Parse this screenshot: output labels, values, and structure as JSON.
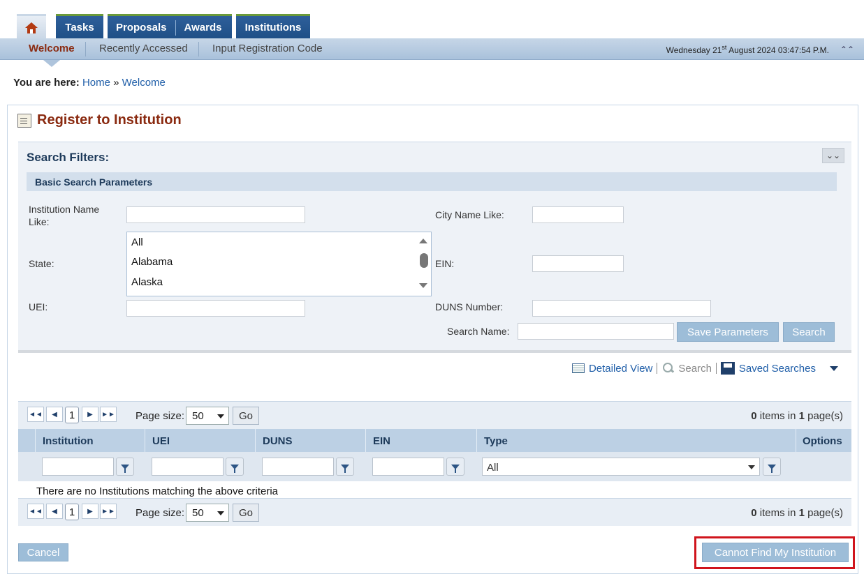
{
  "nav": {
    "home_icon": "home-icon",
    "tabs": [
      "Tasks",
      "Proposals",
      "Awards",
      "Institutions"
    ],
    "subnav": [
      "Welcome",
      "Recently Accessed",
      "Input Registration Code"
    ],
    "datetime_prefix": "Wednesday 21",
    "datetime_sup": "st",
    "datetime_suffix": " August 2024 03:47:54 P.M."
  },
  "breadcrumb": {
    "label": "You are here:",
    "home": "Home",
    "sep": "»",
    "current": "Welcome"
  },
  "page": {
    "title": "Register to Institution"
  },
  "filters": {
    "heading": "Search Filters:",
    "basic_heading": "Basic Search Parameters",
    "labels": {
      "institution_name": "Institution Name Like:",
      "city_name": "City Name Like:",
      "state": "State:",
      "ein": "EIN:",
      "uei": "UEI:",
      "duns": "DUNS Number:",
      "search_name": "Search Name:"
    },
    "state_options": [
      "All",
      "Alabama",
      "Alaska"
    ],
    "buttons": {
      "save": "Save Parameters",
      "search": "Search"
    }
  },
  "toolbar": {
    "detailed_view": "Detailed View",
    "search": "Search",
    "saved_searches": "Saved Searches"
  },
  "pager": {
    "current_page": "1",
    "page_size_label": "Page size:",
    "page_size": "50",
    "go": "Go",
    "count_items": "0",
    "items_text": " items in ",
    "count_pages": "1",
    "pages_text": " page(s)"
  },
  "grid": {
    "columns": [
      "Institution",
      "UEI",
      "DUNS",
      "EIN",
      "Type",
      "Options"
    ],
    "type_filter": "All",
    "empty_message": "There are no Institutions matching the above criteria"
  },
  "actions": {
    "cancel": "Cancel",
    "cannot_find": "Cannot Find My Institution"
  },
  "colors": {
    "brand_dark": "#1e4f86",
    "title": "#8a2a10",
    "button": "#9dbdd8",
    "highlight": "#d0141c"
  }
}
